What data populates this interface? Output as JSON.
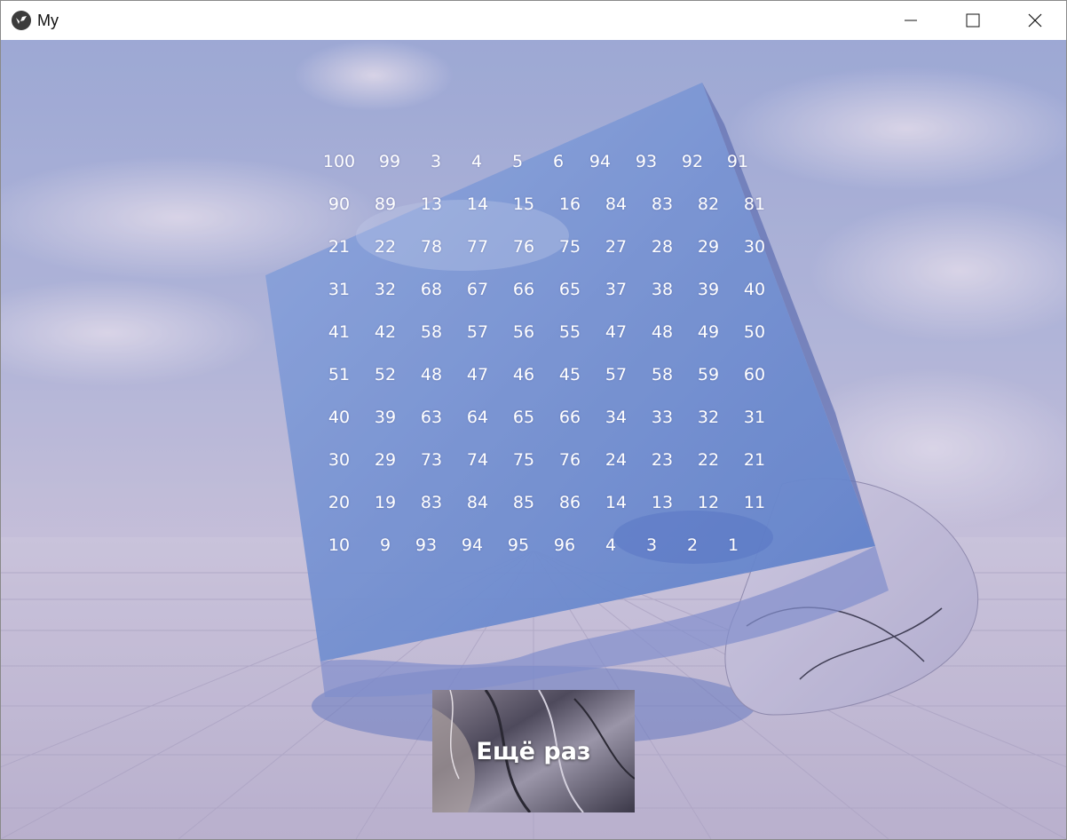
{
  "window": {
    "title": "My",
    "icon": "kivy-logo-icon",
    "controls": [
      "minimize-icon",
      "maximize-icon",
      "close-icon"
    ]
  },
  "grid": {
    "rows": [
      [
        "100",
        "99",
        "3",
        "4",
        "5",
        "6",
        "94",
        "93",
        "92",
        "91"
      ],
      [
        "90",
        "89",
        "13",
        "14",
        "15",
        "16",
        "84",
        "83",
        "82",
        "81"
      ],
      [
        "21",
        "22",
        "78",
        "77",
        "76",
        "75",
        "27",
        "28",
        "29",
        "30"
      ],
      [
        "31",
        "32",
        "68",
        "67",
        "66",
        "65",
        "37",
        "38",
        "39",
        "40"
      ],
      [
        "41",
        "42",
        "58",
        "57",
        "56",
        "55",
        "47",
        "48",
        "49",
        "50"
      ],
      [
        "51",
        "52",
        "48",
        "47",
        "46",
        "45",
        "57",
        "58",
        "59",
        "60"
      ],
      [
        "40",
        "39",
        "63",
        "64",
        "65",
        "66",
        "34",
        "33",
        "32",
        "31"
      ],
      [
        "30",
        "29",
        "73",
        "74",
        "75",
        "76",
        "24",
        "23",
        "22",
        "21"
      ],
      [
        "20",
        "19",
        "83",
        "84",
        "85",
        "86",
        "14",
        "13",
        "12",
        "11"
      ],
      [
        "10",
        "9",
        "93",
        "94",
        "95",
        "96",
        "4",
        "3",
        "2",
        "1"
      ]
    ]
  },
  "button": {
    "label": "Ещё раз"
  },
  "colors": {
    "sky": "#a9b8dd",
    "cube": "#7f9fdc",
    "floor": "#c9c2d6",
    "text": "#ffffff"
  }
}
